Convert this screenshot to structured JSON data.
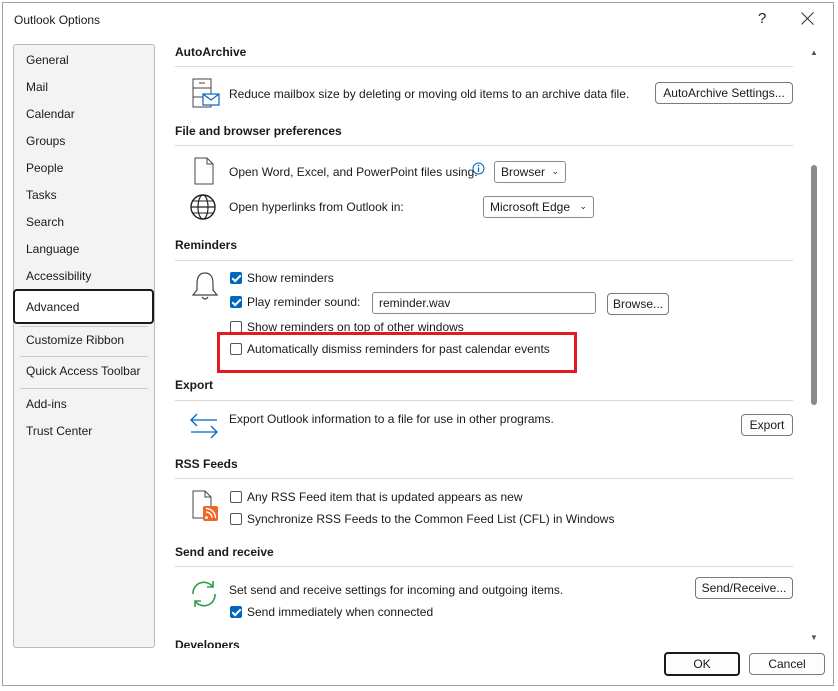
{
  "window": {
    "title": "Outlook Options",
    "help_label": "?"
  },
  "sidebar": {
    "items": [
      {
        "label": "General"
      },
      {
        "label": "Mail"
      },
      {
        "label": "Calendar"
      },
      {
        "label": "Groups"
      },
      {
        "label": "People"
      },
      {
        "label": "Tasks"
      },
      {
        "label": "Search"
      },
      {
        "label": "Language"
      },
      {
        "label": "Accessibility"
      },
      {
        "label": "Advanced",
        "active": true
      },
      {
        "label": "Customize Ribbon"
      },
      {
        "label": "Quick Access Toolbar"
      },
      {
        "label": "Add-ins"
      },
      {
        "label": "Trust Center"
      }
    ]
  },
  "autoarchive": {
    "header": "AutoArchive",
    "description": "Reduce mailbox size by deleting or moving old items to an archive data file.",
    "button": "AutoArchive Settings..."
  },
  "file_browser": {
    "header": "File and browser preferences",
    "open_files_label": "Open Word, Excel, and PowerPoint files using:",
    "open_files_value": "Browser",
    "hyperlinks_label": "Open hyperlinks from Outlook in:",
    "hyperlinks_value": "Microsoft Edge"
  },
  "reminders": {
    "header": "Reminders",
    "show_reminders": {
      "label": "Show reminders",
      "checked": true
    },
    "play_sound": {
      "label": "Play reminder sound:",
      "checked": true
    },
    "sound_file": "reminder.wav",
    "browse_button": "Browse...",
    "on_top": {
      "label": "Show reminders on top of other windows",
      "checked": false
    },
    "auto_dismiss": {
      "label": "Automatically dismiss reminders for past calendar events",
      "checked": false
    }
  },
  "export": {
    "header": "Export",
    "description": "Export Outlook information to a file for use in other programs.",
    "button": "Export"
  },
  "rss": {
    "header": "RSS Feeds",
    "any_item": {
      "label": "Any RSS Feed item that is updated appears as new",
      "checked": false
    },
    "sync": {
      "label": "Synchronize RSS Feeds to the Common Feed List (CFL) in Windows",
      "checked": false
    }
  },
  "send_receive": {
    "header": "Send and receive",
    "description": "Set send and receive settings for incoming and outgoing items.",
    "button": "Send/Receive...",
    "send_immediately": {
      "label": "Send immediately when connected",
      "checked": true
    }
  },
  "developers": {
    "header": "Developers"
  },
  "footer": {
    "ok": "OK",
    "cancel": "Cancel"
  },
  "colors": {
    "accent": "#0067c0",
    "highlight": "#e21b23"
  }
}
